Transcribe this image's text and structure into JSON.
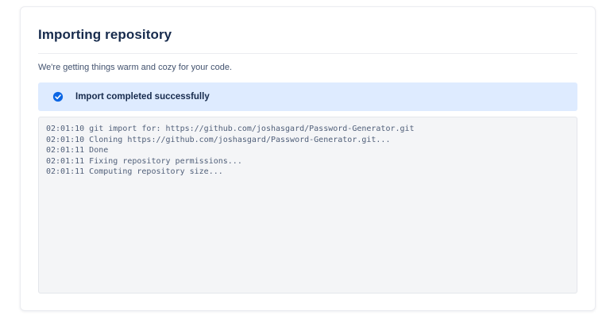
{
  "card": {
    "title": "Importing repository",
    "subtitle": "We're getting things warm and cozy for your code.",
    "banner": {
      "label": "Import completed successfully",
      "icon_name": "check-circle-icon",
      "background_color": "#deebff",
      "icon_color": "#0c66e4",
      "text_color": "#172b4d"
    },
    "log": {
      "background_color": "#f4f5f7",
      "text_color": "#505f79",
      "lines": [
        "02:01:10 git import for: https://github.com/joshasgard/Password-Generator.git",
        "02:01:10 Cloning https://github.com/joshasgard/Password-Generator.git...",
        "02:01:11 Done",
        "02:01:11 Fixing repository permissions...",
        "02:01:11 Computing repository size..."
      ]
    }
  },
  "colors": {
    "title": "#172b4d",
    "subtitle": "#42526e",
    "card_border": "#ebecf0"
  }
}
